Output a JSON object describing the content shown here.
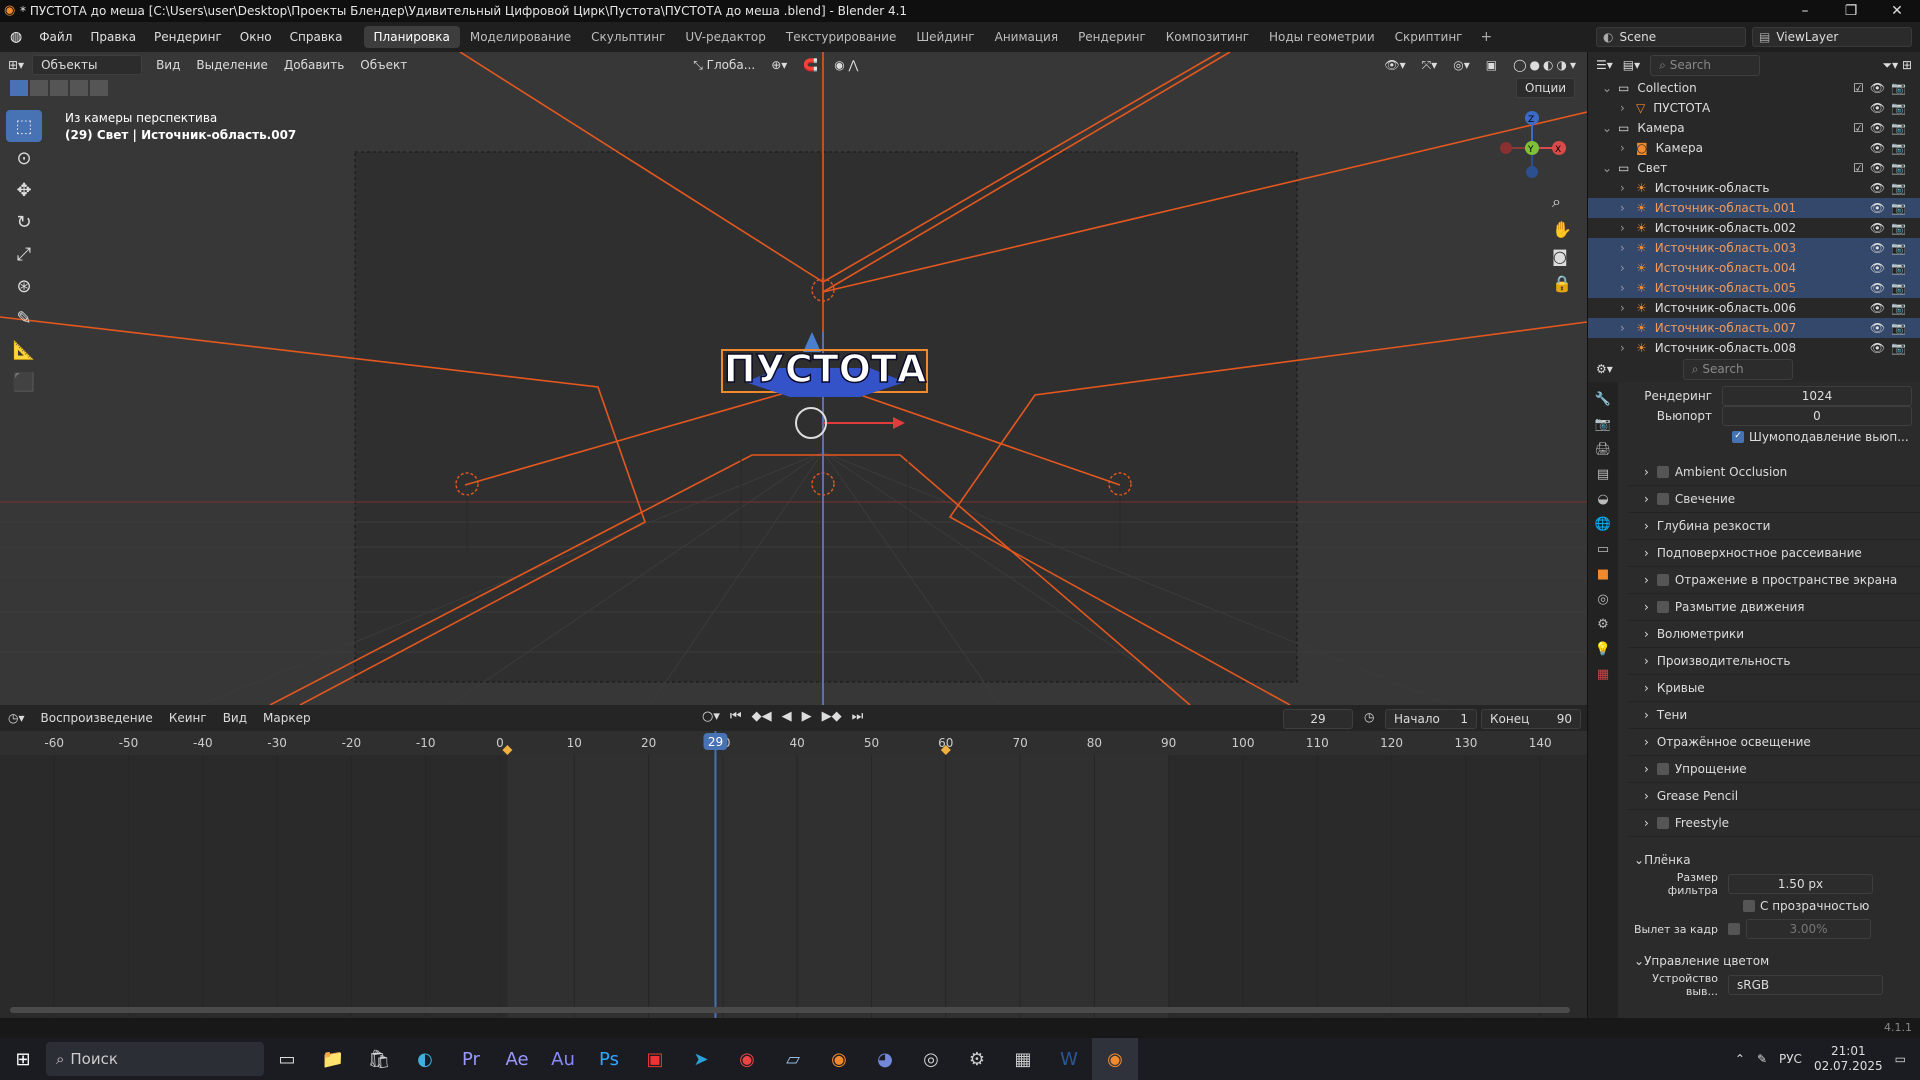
{
  "window": {
    "title": "* ПУСТОТА до меша  [C:\\Users\\user\\Desktop\\Проекты Блендер\\Удивительный Цифровой Цирк\\Пустота\\ПУСТОТА до меша .blend] - Blender 4.1"
  },
  "menu": [
    "Файл",
    "Правка",
    "Рендеринг",
    "Окно",
    "Справка"
  ],
  "workspaces": [
    "Планировка",
    "Моделирование",
    "Скульптинг",
    "UV-редактор",
    "Текстурирование",
    "Шейдинг",
    "Анимация",
    "Рендеринг",
    "Композитинг",
    "Ноды геометрии",
    "Скриптинг"
  ],
  "scene": {
    "name": "Scene",
    "viewlayer": "ViewLayer"
  },
  "viewport": {
    "mode": "Объекты",
    "menus": [
      "Вид",
      "Выделение",
      "Добавить",
      "Объект"
    ],
    "orientation": "Глоба...",
    "options": "Опции",
    "overlay_line1": "Из камеры перспектива",
    "overlay_line2": "(29) Свет | Источник-область.007",
    "logo_text": "ПУСТОТА"
  },
  "outliner": {
    "search": "Search",
    "rows": [
      {
        "label": "Collection",
        "indent": 0,
        "type": "collection",
        "selected": false
      },
      {
        "label": "ПУСТОТА",
        "indent": 1,
        "type": "mesh",
        "selected": false
      },
      {
        "label": "Камера",
        "indent": 0,
        "type": "collection",
        "selected": false
      },
      {
        "label": "Камера",
        "indent": 1,
        "type": "camera",
        "selected": false
      },
      {
        "label": "Свет",
        "indent": 0,
        "type": "collection",
        "selected": false
      },
      {
        "label": "Источник-область",
        "indent": 1,
        "type": "light",
        "selected": false
      },
      {
        "label": "Источник-область.001",
        "indent": 1,
        "type": "light",
        "selected": true
      },
      {
        "label": "Источник-область.002",
        "indent": 1,
        "type": "light",
        "selected": false
      },
      {
        "label": "Источник-область.003",
        "indent": 1,
        "type": "light",
        "selected": true
      },
      {
        "label": "Источник-область.004",
        "indent": 1,
        "type": "light",
        "selected": true
      },
      {
        "label": "Источник-область.005",
        "indent": 1,
        "type": "light",
        "selected": true
      },
      {
        "label": "Источник-область.006",
        "indent": 1,
        "type": "light",
        "selected": false
      },
      {
        "label": "Источник-область.007",
        "indent": 1,
        "type": "light",
        "selected": true
      },
      {
        "label": "Источник-область.008",
        "indent": 1,
        "type": "light",
        "selected": false
      }
    ]
  },
  "properties": {
    "search": "Search",
    "render_label": "Рендеринг",
    "render_value": "1024",
    "viewport_label": "Вьюпорт",
    "viewport_value": "0",
    "denoise_label": "Шумоподавление вьюп...",
    "panels": [
      {
        "label": "Ambient Occlusion",
        "checkbox": true
      },
      {
        "label": "Свечение",
        "checkbox": true
      },
      {
        "label": "Глубина резкости",
        "checkbox": false
      },
      {
        "label": "Подповерхностное рассеивание",
        "checkbox": false
      },
      {
        "label": "Отражение в пространстве экрана",
        "checkbox": true
      },
      {
        "label": "Размытие движения",
        "checkbox": true
      },
      {
        "label": "Волюметрики",
        "checkbox": false
      },
      {
        "label": "Производительность",
        "checkbox": false
      },
      {
        "label": "Кривые",
        "checkbox": false
      },
      {
        "label": "Тени",
        "checkbox": false
      },
      {
        "label": "Отражённое освещение",
        "checkbox": false
      },
      {
        "label": "Упрощение",
        "checkbox": true
      },
      {
        "label": "Grease Pencil",
        "checkbox": false
      },
      {
        "label": "Freestyle",
        "checkbox": true
      }
    ],
    "film_label": "Плёнка",
    "filter_label": "Размер фильтра",
    "filter_value": "1.50 px",
    "transparent_label": "С прозрачностью",
    "overscan_label": "Вылет за кадр",
    "overscan_value": "3.00%",
    "color_label": "Управление цветом",
    "device_label": "Устройство выв...",
    "device_value": "sRGB"
  },
  "timeline": {
    "menus": [
      "Воспроизведение",
      "Кеинг",
      "Вид",
      "Маркер"
    ],
    "current_frame": "29",
    "start_label": "Начало",
    "start_value": "1",
    "end_label": "Конец",
    "end_value": "90",
    "ticks": [
      "-60",
      "-50",
      "-40",
      "-30",
      "-20",
      "-10",
      "0",
      "10",
      "20",
      "30",
      "40",
      "50",
      "60",
      "70",
      "80",
      "90",
      "100",
      "110",
      "120",
      "130",
      "140"
    ],
    "keyframes": [
      1,
      60
    ]
  },
  "status": {
    "version": "4.1.1"
  },
  "taskbar": {
    "search": "Поиск",
    "lang": "РУС",
    "time": "21:01",
    "date": "02.07.2025"
  }
}
